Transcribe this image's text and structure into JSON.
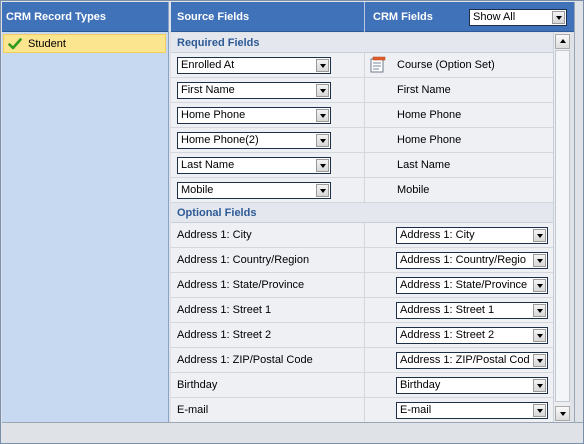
{
  "left_panel": {
    "header": "CRM Record Types",
    "items": [
      {
        "label": "Student",
        "selected": true
      }
    ]
  },
  "header": {
    "source_label": "Source Fields",
    "crm_label": "CRM Fields",
    "filter_value": "Show All"
  },
  "required": {
    "title": "Required Fields",
    "rows": [
      {
        "source": "Enrolled At",
        "crm": "Course (Option Set)",
        "icon": "option-set-icon"
      },
      {
        "source": "First Name",
        "crm": "First Name"
      },
      {
        "source": "Home Phone",
        "crm": "Home Phone"
      },
      {
        "source": "Home Phone(2)",
        "crm": "Home Phone"
      },
      {
        "source": "Last Name",
        "crm": "Last Name"
      },
      {
        "source": "Mobile",
        "crm": "Mobile"
      }
    ]
  },
  "optional": {
    "title": "Optional Fields",
    "rows": [
      {
        "source": "Address 1: City",
        "crm": "Address 1: City"
      },
      {
        "source": "Address 1: Country/Region",
        "crm": "Address 1: Country/Regio"
      },
      {
        "source": "Address 1: State/Province",
        "crm": "Address 1: State/Province"
      },
      {
        "source": "Address 1: Street 1",
        "crm": "Address 1: Street 1"
      },
      {
        "source": "Address 1: Street 2",
        "crm": "Address 1: Street 2"
      },
      {
        "source": "Address 1: ZIP/Postal Code",
        "crm": "Address 1: ZIP/Postal Cod"
      },
      {
        "source": "Birthday",
        "crm": "Birthday"
      },
      {
        "source": "E-mail",
        "crm": "E-mail"
      }
    ]
  },
  "colors": {
    "header_bg": "#3f72b8",
    "left_panel_bg": "#c6d9f1",
    "selected_bg": "#fbe58f",
    "section_title": "#2d5a96"
  }
}
